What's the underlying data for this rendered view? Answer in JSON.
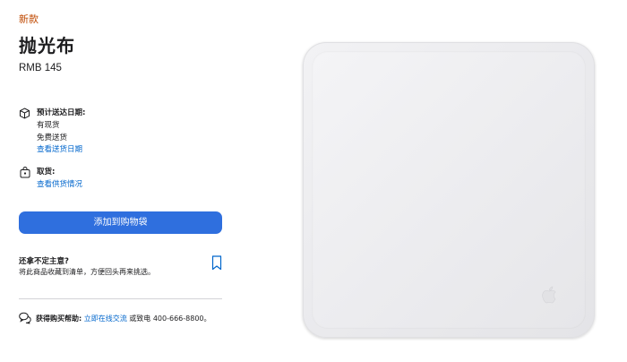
{
  "product": {
    "badge": "新款",
    "name": "抛光布",
    "price": "RMB 145"
  },
  "delivery": {
    "title": "预计送达日期:",
    "stock": "有现货",
    "shipping": "免费送货",
    "link": "查看送货日期"
  },
  "pickup": {
    "title": "取货:",
    "link": "查看供货情况"
  },
  "cta": {
    "label": "添加到购物袋"
  },
  "save": {
    "title": "还拿不定主意?",
    "description": "将此商品收藏到清单，方便回头再来挑选。"
  },
  "help": {
    "prefix": "获得购买帮助:",
    "link": "立即在线交流",
    "suffix": "或致电 400-666-8800。"
  },
  "colors": {
    "accent": "#2f6fde",
    "link": "#0066cc",
    "badge": "#bf4800"
  },
  "icons": {
    "delivery": "box-icon",
    "pickup": "bag-icon",
    "save": "bookmark-icon",
    "help": "chat-bubbles-icon",
    "logo": "apple-logo-icon"
  }
}
